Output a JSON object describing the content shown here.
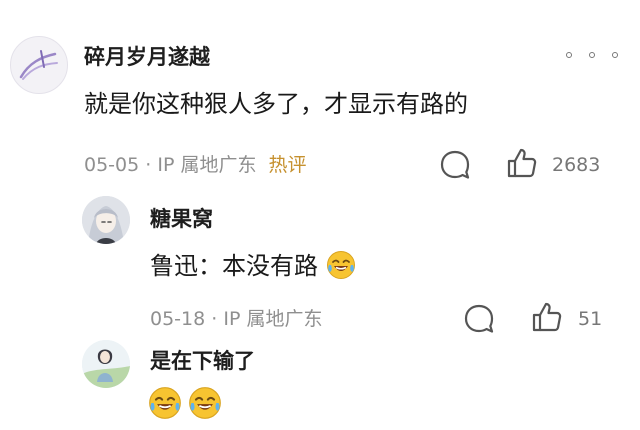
{
  "main_comment": {
    "username": "碎月岁月遂越",
    "text": "就是你这种狠人多了，才显示有路的",
    "date": "05-05",
    "ip_location": "IP 属地广东",
    "hot_badge": "热评",
    "like_count": "2683",
    "icons": [
      "avatar-moon-logo",
      "more-dots-icon",
      "comment-bubble-icon",
      "thumbs-up-icon"
    ]
  },
  "replies": [
    {
      "username": "糖果窝",
      "text": "鲁迅：本没有路",
      "trailing_emoji": "laughing-crying-emoji",
      "date": "05-18",
      "ip_location": "IP 属地广东",
      "like_count": "51"
    },
    {
      "username": "是在下输了",
      "emojis": [
        "laughing-crying-emoji",
        "laughing-crying-emoji"
      ]
    }
  ],
  "colors": {
    "text_primary": "#1a1a1a",
    "text_meta": "#8f8f8f",
    "hot_badge": "#c6912f",
    "emoji_yellow": "#f7c431"
  },
  "separator": "·"
}
